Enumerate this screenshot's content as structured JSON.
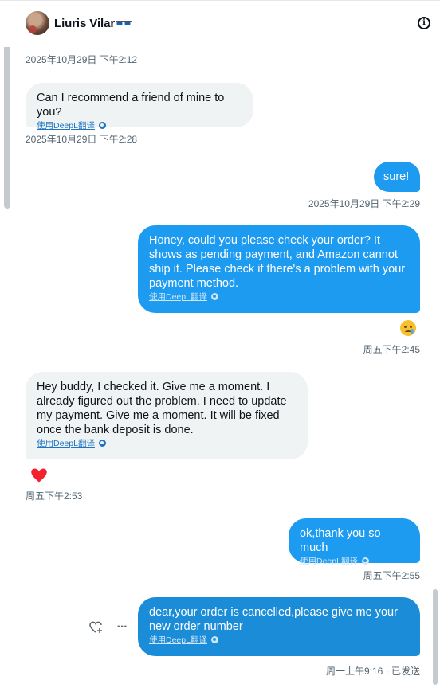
{
  "header": {
    "name": "Liuris Vilar",
    "name_emoji_icon": "sunglasses-icon",
    "info_icon": "info-icon"
  },
  "translate_label": "使用DeepL翻译",
  "messages": [
    {
      "id": "m0",
      "side": "in",
      "reaction": "heart",
      "time": "2025年10月29日 下午2:12"
    },
    {
      "id": "m1",
      "side": "in",
      "text": "Can I recommend a friend of mine to you?",
      "translate": true,
      "time": "2025年10月29日 下午2:28"
    },
    {
      "id": "m2",
      "side": "out",
      "text": "sure!",
      "translate": false,
      "time": "2025年10月29日 下午2:29"
    },
    {
      "id": "m3",
      "side": "out",
      "text": "Honey, could you please check your order? It shows as pending payment, and Amazon cannot ship it. Please check if there's a problem with your payment method.",
      "translate": true,
      "reaction": "crying-face",
      "time": "周五下午2:45"
    },
    {
      "id": "m4",
      "side": "in",
      "text": "Hey buddy, I checked it. Give me a moment. I already figured out the problem. I need to update my payment. Give me a moment. It will be fixed once the bank deposit is done.",
      "translate": true,
      "reaction": "heart",
      "time": "周五下午2:53"
    },
    {
      "id": "m5",
      "side": "out",
      "text": "ok,thank you so much",
      "translate": true,
      "time": "周五下午2:55"
    },
    {
      "id": "m6",
      "side": "out",
      "text": "dear,your order is cancelled,please give me your new order number",
      "translate": true,
      "time": "周一上午9:16 · 已发送"
    }
  ],
  "colors": {
    "outgoing": "#1d9bf0",
    "incoming": "#eff3f4",
    "heart": "#f4212e",
    "meta": "#536471"
  }
}
